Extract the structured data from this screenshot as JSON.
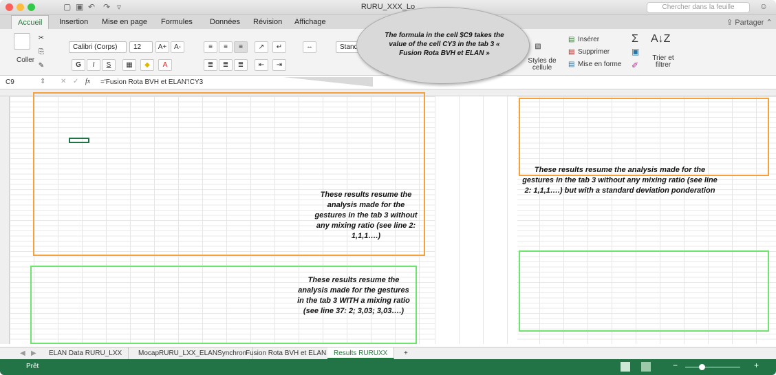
{
  "window": {
    "title": "RURU_XXX_Lo",
    "search_placeholder": "Chercher dans la feuille"
  },
  "ribbon_tabs": [
    "Accueil",
    "Insertion",
    "Mise en page",
    "Formules",
    "Données",
    "Révision",
    "Affichage"
  ],
  "share_label": "Partager",
  "clipboard": {
    "paste_label": "Coller"
  },
  "font": {
    "name": "Calibri (Corps)",
    "size": "12"
  },
  "number_format": "Standard",
  "styles": {
    "cell_styles_label": "Styles de cellule"
  },
  "cells_group": {
    "insert": "Insérer",
    "delete": "Supprimer",
    "format": "Mise en forme"
  },
  "editing": {
    "sort_filter": "Trier et filtrer"
  },
  "formula_bar": {
    "cell_ref": "C9",
    "formula": "='Fusion Rota BVH et ELAN'!CY3"
  },
  "callout": "The formula in the cell $C9 takes the value of the cell CY3 in the tab 3 « Fusion Rota BVH et ELAN »",
  "notes": {
    "orange_left": "These results resume the analysis made for the gestures in the tab 3 without any mixing ratio (see line 2: 1,1,1….)",
    "orange_right": "These results resume the analysis made for the gestures in the tab 3 without any mixing ratio (see line 2: 1,1,1….) but with a standard deviation ponderation",
    "green_left": "These results resume the analysis made for the gestures in the tab 3 WITH a mixing ratio (see line 37: 2; 3,03; 3,03….)"
  },
  "sheet_tabs": [
    "ELAN Data RURU_LXX",
    "MocapRURU_LXX_ELANSynchron",
    "Fusion Rota BVH et ELAN",
    "Results RURUXX"
  ],
  "active_sheet": "Results RURUXX",
  "status": "Prêt",
  "colors": {
    "accent": "#217346",
    "orange": "#f5a03a",
    "green": "#6ee36e",
    "callout": "#d9d9d9"
  }
}
